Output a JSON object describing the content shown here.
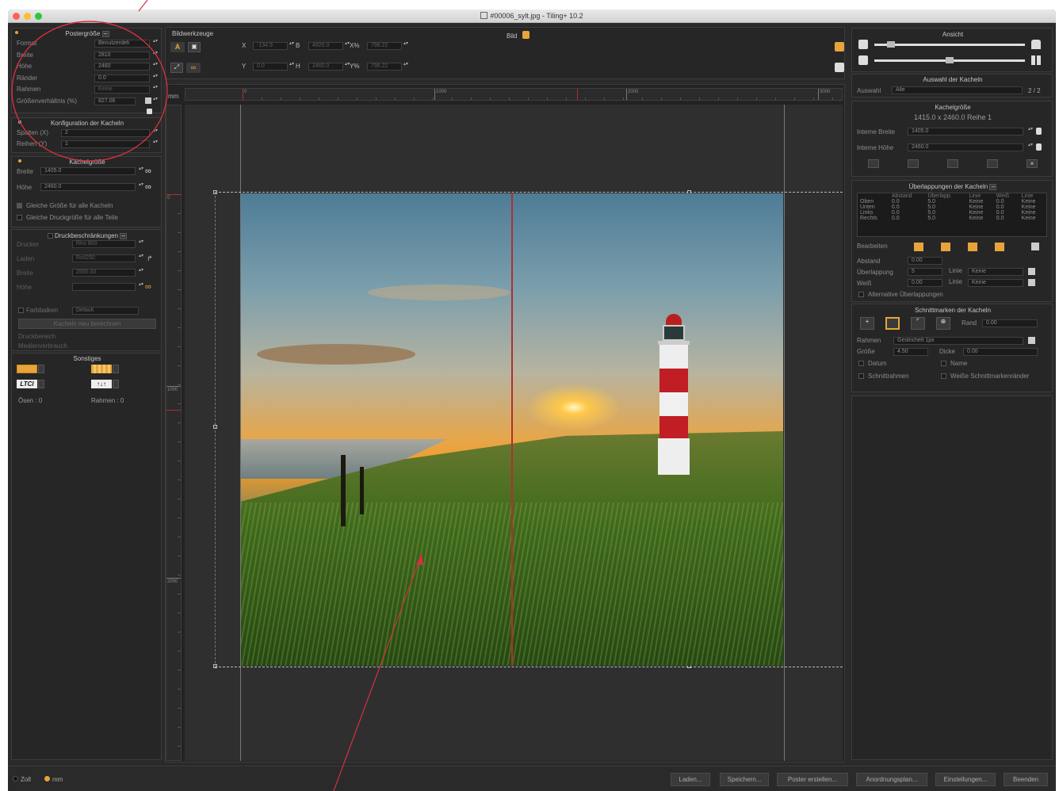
{
  "window": {
    "title": "#00006_sylt.jpg - Tiling+ 10.2"
  },
  "left": {
    "poster": {
      "header": "Postergröße",
      "rows": [
        {
          "label": "Format",
          "value": "Benutzerdefi"
        },
        {
          "label": "Breite",
          "value": "2810"
        },
        {
          "label": "Höhe",
          "value": "2460"
        },
        {
          "label": "Ränder",
          "value": "0.0"
        },
        {
          "label": "Rahmen",
          "value": "Keine"
        },
        {
          "label": "Größenverhältnis (%)",
          "value": "827.06"
        }
      ]
    },
    "config": {
      "header": "Konfiguration der Kacheln",
      "rows": [
        {
          "label": "Spalten (X)",
          "value": "2"
        },
        {
          "label": "Reihen (Y)",
          "value": "1"
        }
      ]
    },
    "tilesize": {
      "header": "Kachelgröße",
      "rows": [
        {
          "label": "Breite",
          "value": "1405.0"
        },
        {
          "label": "Höhe",
          "value": "2460.0"
        }
      ],
      "checks": [
        {
          "label": "Gleiche Größe für alle Kacheln",
          "checked": true
        },
        {
          "label": "Gleiche Druckgröße für alle Teile",
          "checked": false
        }
      ]
    },
    "print": {
      "header": "Druckbeschränkungen",
      "rows": [
        {
          "label": "Drucker",
          "value": "Rho 800"
        },
        {
          "label": "Laden",
          "value": "Roll250"
        },
        {
          "label": "Breite",
          "value": "2500.00"
        },
        {
          "label": "Höhe",
          "value": ""
        }
      ],
      "color_label": "Farbbalken",
      "color_value": "Default",
      "recalc": "Kacheln neu berechnen",
      "area": "Druckbereich",
      "media": "Medienverbrauch"
    },
    "misc": {
      "header": "Sonstiges",
      "eyelets": "Ösen : 0",
      "frames": "Rahmen : 0",
      "ltr": "LTCl"
    }
  },
  "tools": {
    "header": "Bildwerkzeuge",
    "bild": "Bild",
    "row1": [
      {
        "label": "X",
        "value": "-134.9"
      },
      {
        "label": "B",
        "value": "4920.0"
      },
      {
        "label": "X%",
        "value": "798.22"
      }
    ],
    "row2": [
      {
        "label": "Y",
        "value": "0.0"
      },
      {
        "label": "H",
        "value": "2460.0"
      },
      {
        "label": "Y%",
        "value": "798.22"
      }
    ]
  },
  "ruler": {
    "unit": "mm",
    "h_ticks": [
      "0",
      "1000",
      "2000",
      "3000"
    ],
    "v_ticks": [
      "0",
      "1000",
      "2000"
    ]
  },
  "right": {
    "view": {
      "header": "Ansicht"
    },
    "selection": {
      "header": "Auswahl der Kacheln",
      "label": "Auswahl",
      "value": "Alle",
      "count": "2 / 2"
    },
    "tilesize": {
      "header": "Kachelgröße",
      "summary": "1415.0 x 2460.0   Reihe 1",
      "rows": [
        {
          "label": "Interne Breite",
          "value": "1405.0"
        },
        {
          "label": "Interne Höhe",
          "value": "2460.0"
        }
      ]
    },
    "overlap": {
      "header": "Überlappungen der Kacheln",
      "columns": [
        "Abstand",
        "Überlapp.",
        "Linie",
        "Weiß",
        "Linie"
      ],
      "rows": [
        [
          "Oben",
          "0.0",
          "5.0",
          "Keine",
          "0.0",
          "Keine"
        ],
        [
          "Unten",
          "0.0",
          "5.0",
          "Keine",
          "0.0",
          "Keine"
        ],
        [
          "Links",
          "0.0",
          "5.0",
          "Keine",
          "0.0",
          "Keine"
        ],
        [
          "Rechts",
          "0.0",
          "5.0",
          "Keine",
          "0.0",
          "Keine"
        ]
      ],
      "edit": "Bearbeiten",
      "abstand_label": "Abstand",
      "abstand": "0.00",
      "ueber_label": "Überlappung",
      "ueber": "5",
      "weiss_label": "Weiß",
      "weiss": "0.00",
      "linie_label": "Linie",
      "linie1": "Keine",
      "linie2": "Keine",
      "alt": "Alternative Überlappungen"
    },
    "cut": {
      "header": "Schnittmarken der Kacheln",
      "rand_label": "Rand",
      "rand": "0.00",
      "rahmen_label": "Rahmen",
      "rahmen": "Gestrichelt 1px",
      "groesse_label": "Größe",
      "groesse": "4.50",
      "dicke_label": "Dicke",
      "dicke": "0.00",
      "datum": "Datum",
      "name": "Name",
      "schnittrahmen": "Schnittrahmen",
      "weisse": "Weiße Schnittmarkenränder"
    }
  },
  "bottom": {
    "units": [
      {
        "label": "Zoll",
        "selected": false
      },
      {
        "label": "mm",
        "selected": true
      }
    ],
    "buttons": [
      "Laden...",
      "Speichern...",
      "Poster erstellen...",
      "Anordnungsplan...",
      "Einstellungen...",
      "Beenden"
    ]
  },
  "colors": {
    "accent": "#e8a33a",
    "annotation": "#d43040",
    "guide": "#b03030"
  }
}
